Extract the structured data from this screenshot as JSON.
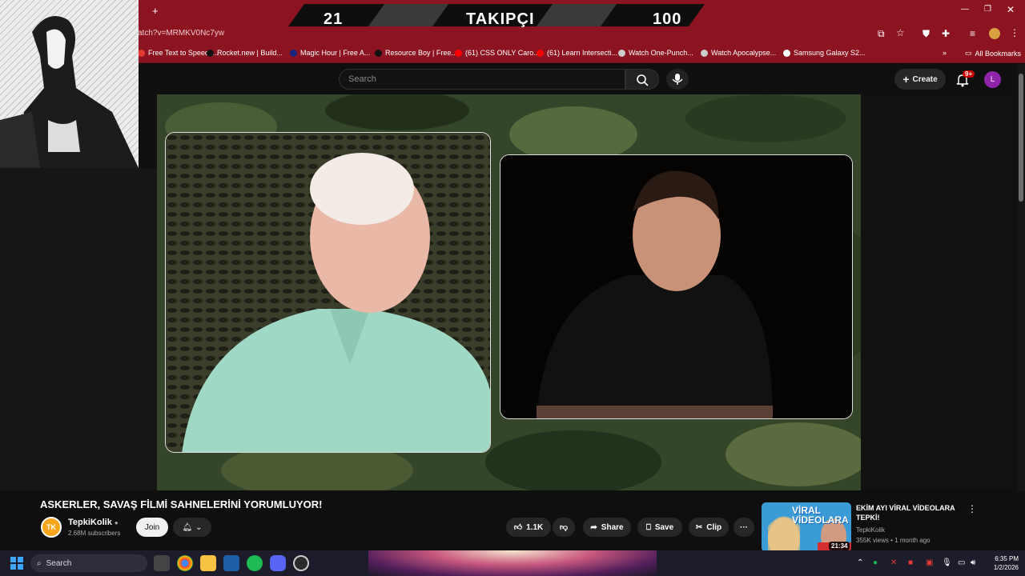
{
  "browser": {
    "url_fragment": "atch?v=MRMKV0Nc7yw",
    "new_tab_symbol": "+",
    "bookmarks": [
      {
        "label": "Free Text to Speech...",
        "color": "#e53935"
      },
      {
        "label": "Rocket.new | Build...",
        "color": "#111111"
      },
      {
        "label": "Magic Hour | Free A...",
        "color": "#1a237e"
      },
      {
        "label": "Resource Boy | Free...",
        "color": "#111111"
      },
      {
        "label": "(61) CSS ONLY Caro...",
        "color": "#ff0000"
      },
      {
        "label": "(61) Learn Intersecti...",
        "color": "#ff0000"
      },
      {
        "label": "Watch One-Punch...",
        "color": "#cccccc"
      },
      {
        "label": "Watch Apocalypse...",
        "color": "#cccccc"
      },
      {
        "label": "Samsung Galaxy S2...",
        "color": "#ffffff"
      }
    ],
    "all_bookmarks_label": "All Bookmarks",
    "more_bookmarks": "»"
  },
  "overlay": {
    "left_count": "21",
    "title": "TAKIPÇI",
    "right_count": "100"
  },
  "youtube": {
    "search_placeholder": "Search",
    "create_label": "Create",
    "notif_badge": "9+",
    "avatar_letter": "L",
    "video_title": "ASKERLER, SAVAŞ FİLMİ SAHNELERİNİ YORUMLUYOR!",
    "channel": {
      "logo_text": "TK",
      "name": "TepkiKolik",
      "subscribers": "2.68M subscribers",
      "join_label": "Join"
    },
    "actions": {
      "likes": "1.1K",
      "share": "Share",
      "save": "Save",
      "clip": "Clip",
      "more": "···"
    },
    "recommended": {
      "title": "EKİM AYI VİRAL VİDEOLARA TEPKİ!",
      "thumb_text": "VİRAL VİDEOLARA",
      "channel": "TepkiKolik",
      "meta": "355K views • 1 month ago",
      "duration": "21:34"
    }
  },
  "taskbar": {
    "search_label": "Search",
    "time": "6:35 PM",
    "date": "1/2/2026"
  },
  "colors": {
    "chrome_red": "#8c1420",
    "yt_bg": "#0f0f0f",
    "accent_red": "#cc0000"
  }
}
